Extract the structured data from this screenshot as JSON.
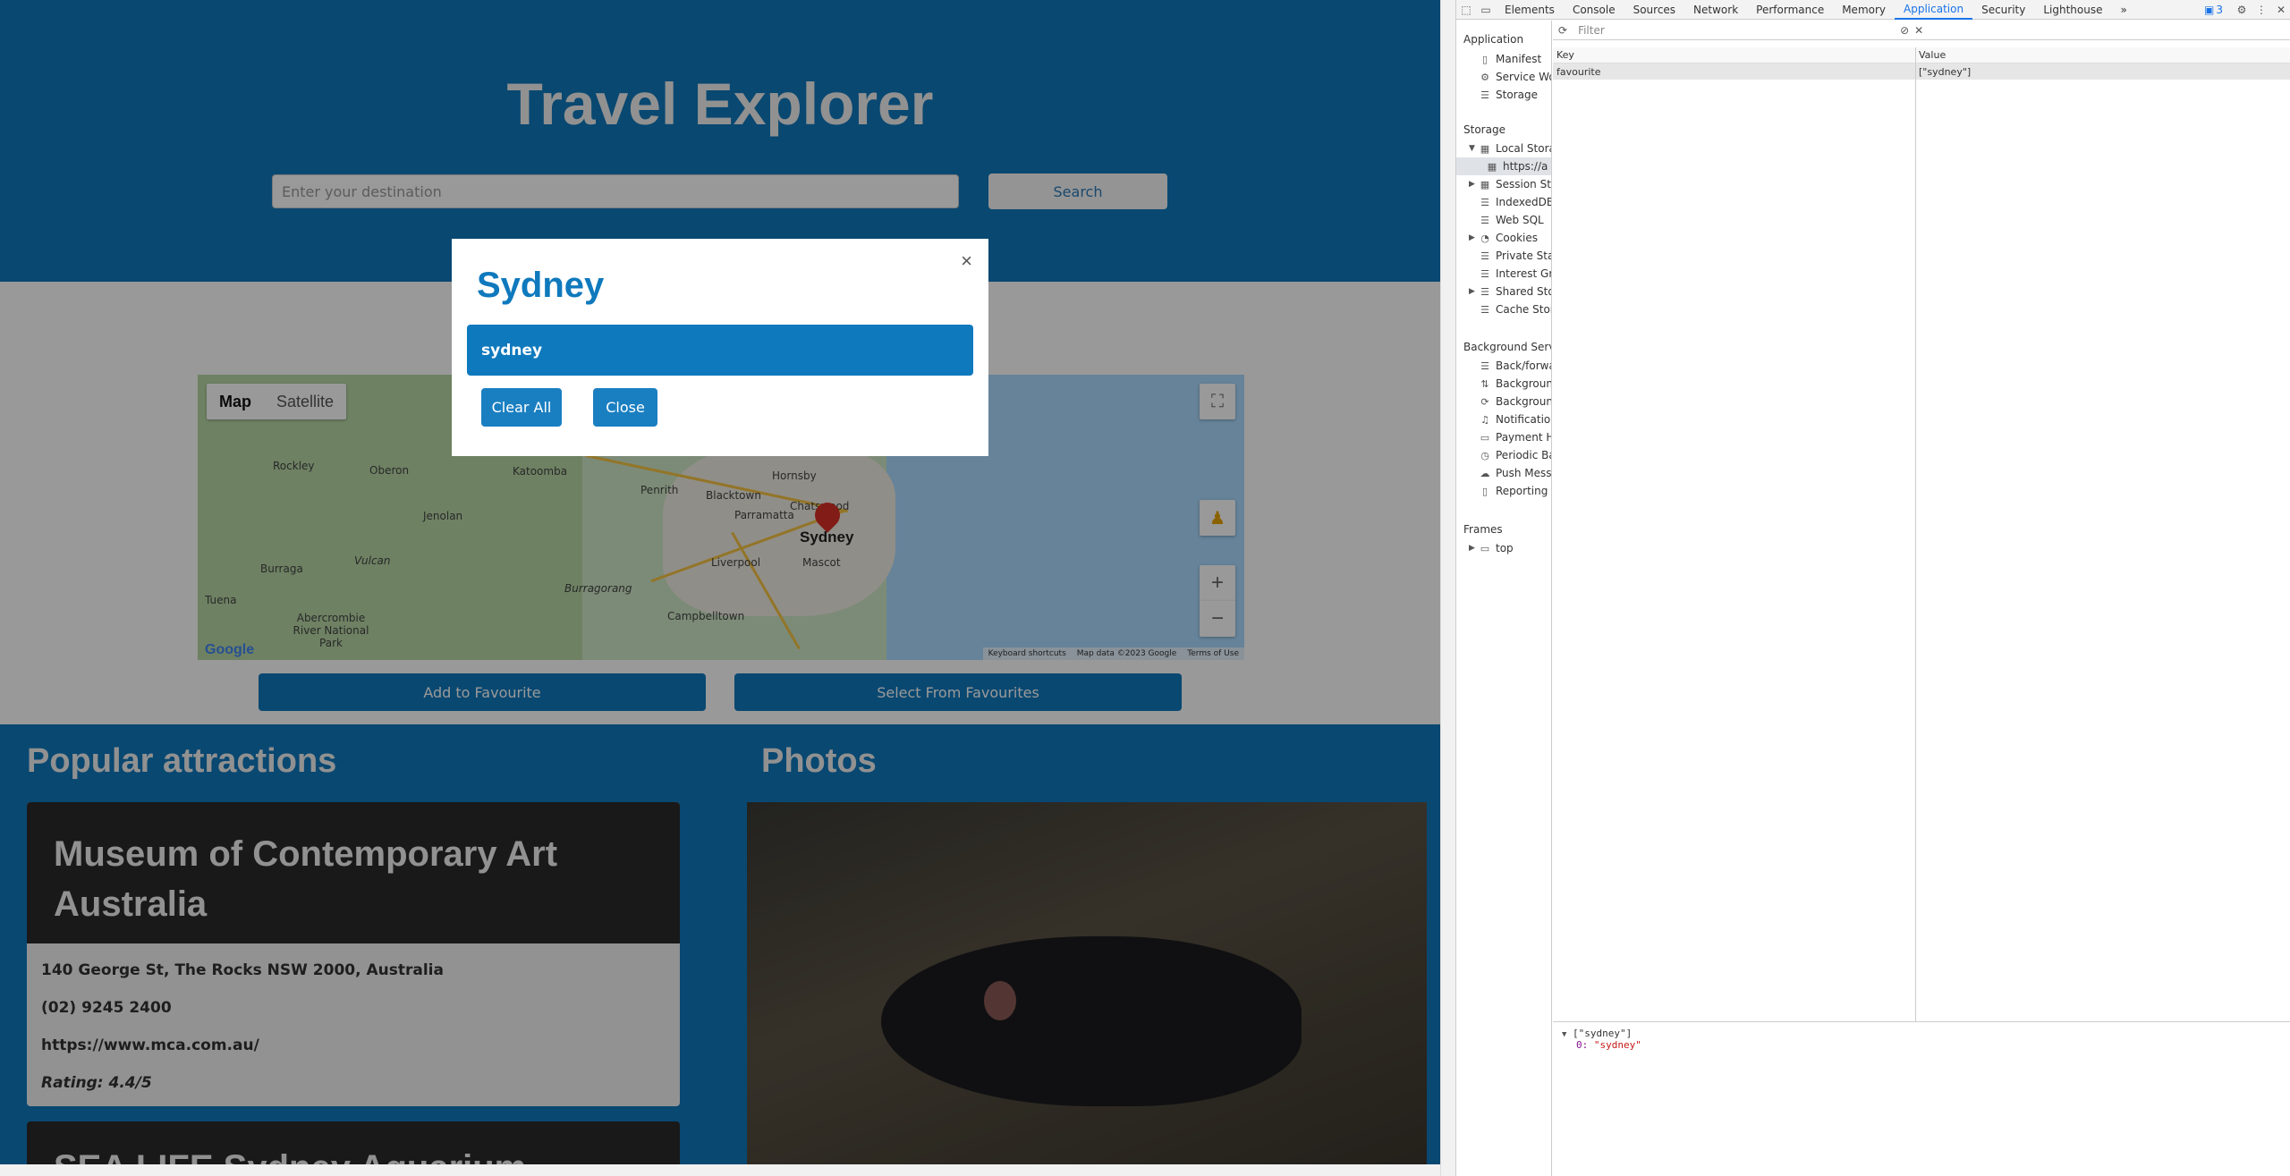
{
  "app": {
    "title": "Travel Explorer",
    "search_placeholder": "Enter your destination",
    "search_button": "Search"
  },
  "map": {
    "type_map": "Map",
    "type_satellite": "Satellite",
    "marker_label": "Sydney",
    "places": [
      "Rockley",
      "Oberon",
      "Katoomba",
      "Penrith",
      "Blacktown",
      "Hornsby",
      "Jenolan",
      "Parramatta",
      "Chatswood",
      "Burraga",
      "Vulcan",
      "Liverpool",
      "Mascot",
      "Burragorang",
      "Tuena",
      "Abercrombie River National Park",
      "Campbelltown"
    ],
    "footer_shortcuts": "Keyboard shortcuts",
    "footer_data": "Map data ©2023 Google",
    "footer_terms": "Terms of Use",
    "logo": "Google",
    "zoom_in": "+",
    "zoom_out": "−"
  },
  "actions": {
    "add_favourite": "Add to Favourite",
    "select_favourites": "Select From Favourites"
  },
  "attractions": {
    "heading": "Popular attractions",
    "card": {
      "name": "Museum of Contemporary Art Australia",
      "address": "140 George St, The Rocks NSW 2000, Australia",
      "phone": "(02) 9245 2400",
      "website": "https://www.mca.com.au/",
      "rating": "Rating: 4.4/5"
    },
    "next_card_name": "SEA LIFE Sydney Aquarium"
  },
  "photos": {
    "heading": "Photos"
  },
  "modal": {
    "title": "Sydney",
    "close_x": "×",
    "item": "sydney",
    "clear_all": "Clear All",
    "close": "Close"
  },
  "devtools": {
    "tabs": [
      "Elements",
      "Console",
      "Sources",
      "Network",
      "Performance",
      "Memory",
      "Application",
      "Security",
      "Lighthouse"
    ],
    "more_tabs": "»",
    "issues_badge": "3",
    "sidebar": {
      "application_heading": "Application",
      "application_items": [
        "Manifest",
        "Service Wo",
        "Storage"
      ],
      "storage_heading": "Storage",
      "storage_items": [
        "Local Stora",
        "https://a",
        "Session Sto",
        "IndexedDB",
        "Web SQL",
        "Cookies",
        "Private Stat",
        "Interest Gro",
        "Shared Sto",
        "Cache Stor"
      ],
      "background_heading": "Background Servic",
      "background_items": [
        "Back/forwa",
        "Backgroun",
        "Backgroun",
        "Notification",
        "Payment H",
        "Periodic Ba",
        "Push Messa",
        "Reporting A"
      ],
      "frames_heading": "Frames",
      "frames_items": [
        "top"
      ]
    },
    "filter_placeholder": "Filter",
    "table": {
      "col_key": "Key",
      "col_value": "Value",
      "rows": [
        {
          "key": "favourite",
          "value": "[\"sydney\"]"
        }
      ]
    },
    "preview": {
      "summary": "[\"sydney\"]",
      "index": "0:",
      "value": "\"sydney\""
    }
  }
}
